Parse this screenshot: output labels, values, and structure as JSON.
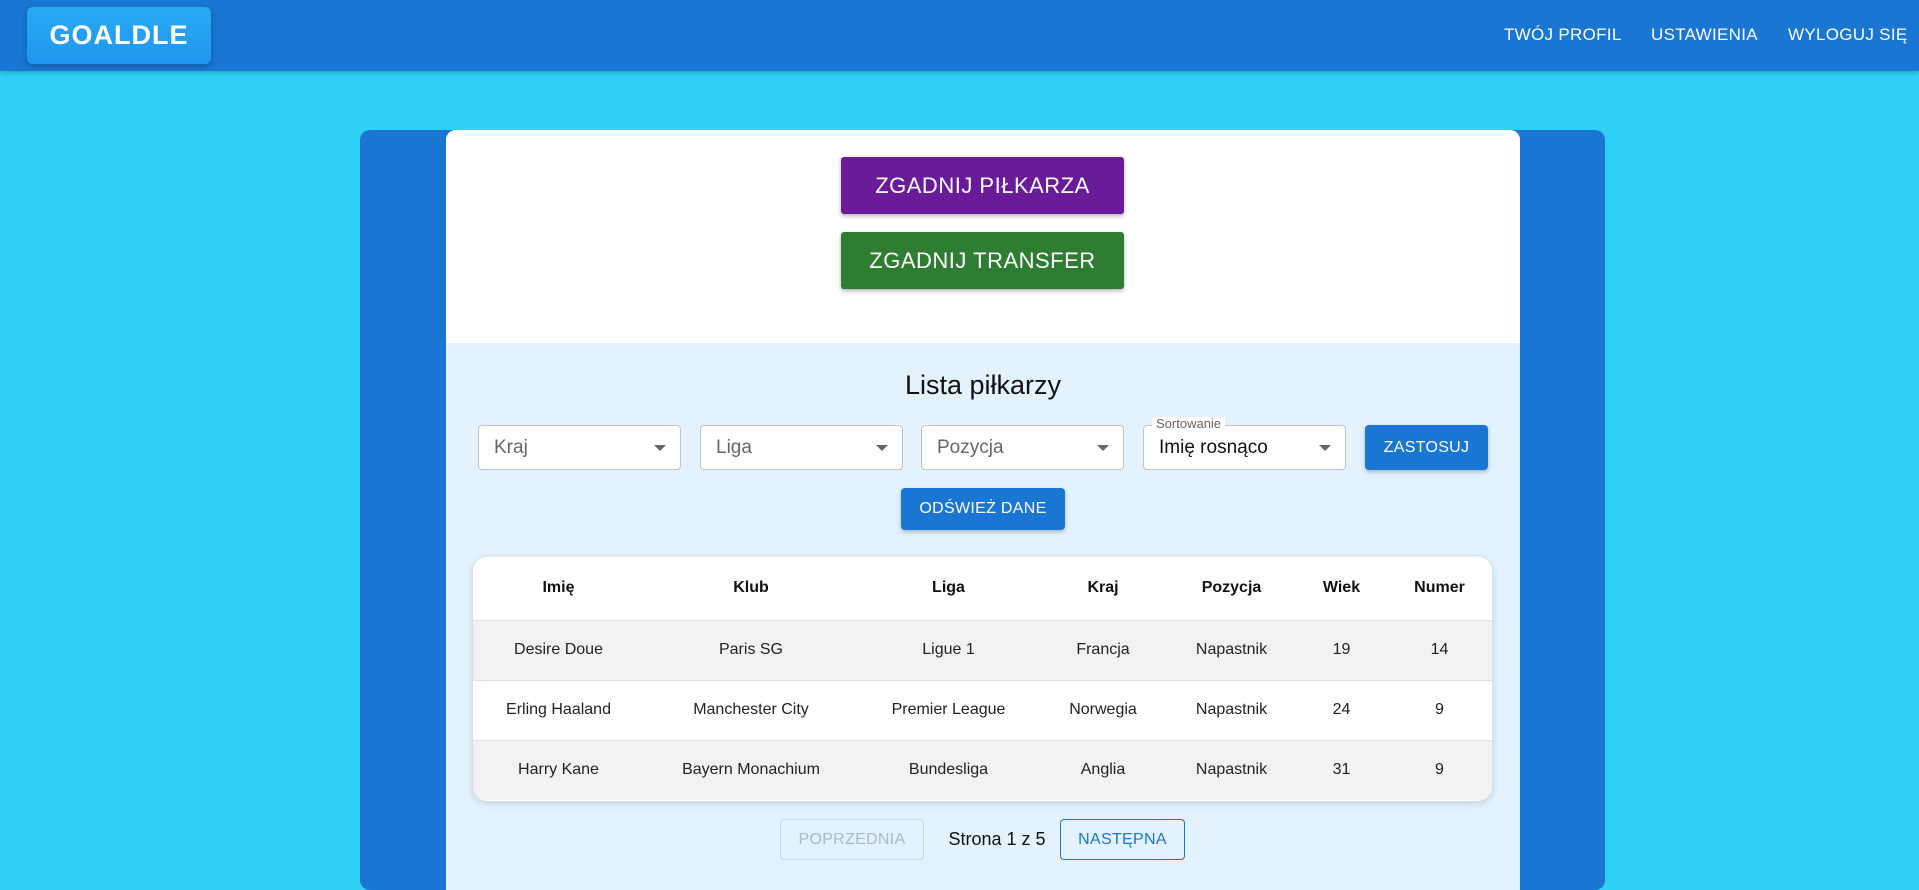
{
  "header": {
    "logo": "GOALDLE",
    "nav": [
      "TWÓJ PROFIL",
      "USTAWIENIA",
      "WYLOGUJ SIĘ"
    ]
  },
  "game_buttons": {
    "guess_player": "ZGADNIJ PIŁKARZA",
    "guess_transfer": "ZGADNIJ TRANSFER"
  },
  "players_list": {
    "title": "Lista piłkarzy",
    "filters": {
      "country_placeholder": "Kraj",
      "league_placeholder": "Liga",
      "position_placeholder": "Pozycja",
      "sort_label": "Sortowanie",
      "sort_value": "Imię rosnąco"
    },
    "apply_label": "ZASTOSUJ",
    "refresh_label": "ODŚWIEŻ DANE",
    "columns": [
      "Imię",
      "Klub",
      "Liga",
      "Kraj",
      "Pozycja",
      "Wiek",
      "Numer"
    ],
    "rows": [
      [
        "Desire Doue",
        "Paris SG",
        "Ligue 1",
        "Francja",
        "Napastnik",
        "19",
        "14"
      ],
      [
        "Erling Haaland",
        "Manchester City",
        "Premier League",
        "Norwegia",
        "Napastnik",
        "24",
        "9"
      ],
      [
        "Harry Kane",
        "Bayern Monachium",
        "Bundesliga",
        "Anglia",
        "Napastnik",
        "31",
        "9"
      ]
    ],
    "pagination": {
      "prev_label": "POPRZEDNIA",
      "info": "Strona 1 z 5",
      "next_label": "NASTĘPNA"
    }
  },
  "colors": {
    "background": "#2fd0f5",
    "primary": "#1976d2",
    "purple_button": "#6a1b9a",
    "green_button": "#2e7d32"
  }
}
